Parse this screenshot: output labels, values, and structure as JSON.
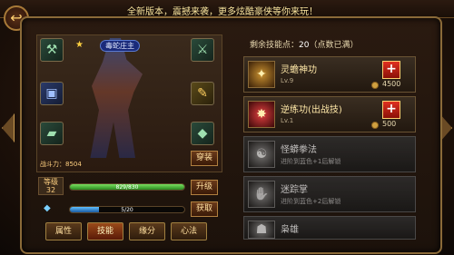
{
  "announcement": "全新版本，震撼来袭，更多炫酷豪侠等你来玩！",
  "character": {
    "name": "毒蛇庄主",
    "combat_power": "战斗力：8504",
    "wear_label": "穿装",
    "level_label": "等级",
    "level": "32",
    "exp_bar": {
      "label": "829/830",
      "fraction": 0.9988
    },
    "energy_bar": {
      "label": "5/20",
      "fraction": 0.25
    },
    "upgrade_label": "升级",
    "obtain_label": "获取",
    "equip_slots": [
      "axe-icon",
      "armor-icon",
      "boots-icon",
      "blade-icon",
      "scroll-icon",
      "jade-icon"
    ]
  },
  "tabs": [
    {
      "label": "属性",
      "active": false
    },
    {
      "label": "技能",
      "active": true
    },
    {
      "label": "缘分",
      "active": false
    },
    {
      "label": "心法",
      "active": false
    }
  ],
  "skills_panel": {
    "points_label": "剩余技能点：",
    "points_value": "20",
    "points_note": "（点数已满）",
    "skills": [
      {
        "name": "灵蟾神功",
        "sub": "Lv.9",
        "cost": "4500",
        "locked": false,
        "icon": "toad-icon"
      },
      {
        "name": "逆练功(出战技)",
        "sub": "Lv.1",
        "cost": "500",
        "locked": false,
        "icon": "fist-icon"
      },
      {
        "name": "怪蟒拳法",
        "sub": "进阶到蓝色+1后解锁",
        "locked": true,
        "icon": "python-icon"
      },
      {
        "name": "迷踪掌",
        "sub": "进阶到蓝色+2后解锁",
        "locked": true,
        "icon": "palm-icon"
      },
      {
        "name": "枭雄",
        "sub": "",
        "locked": true,
        "icon": "hero-icon"
      }
    ]
  }
}
